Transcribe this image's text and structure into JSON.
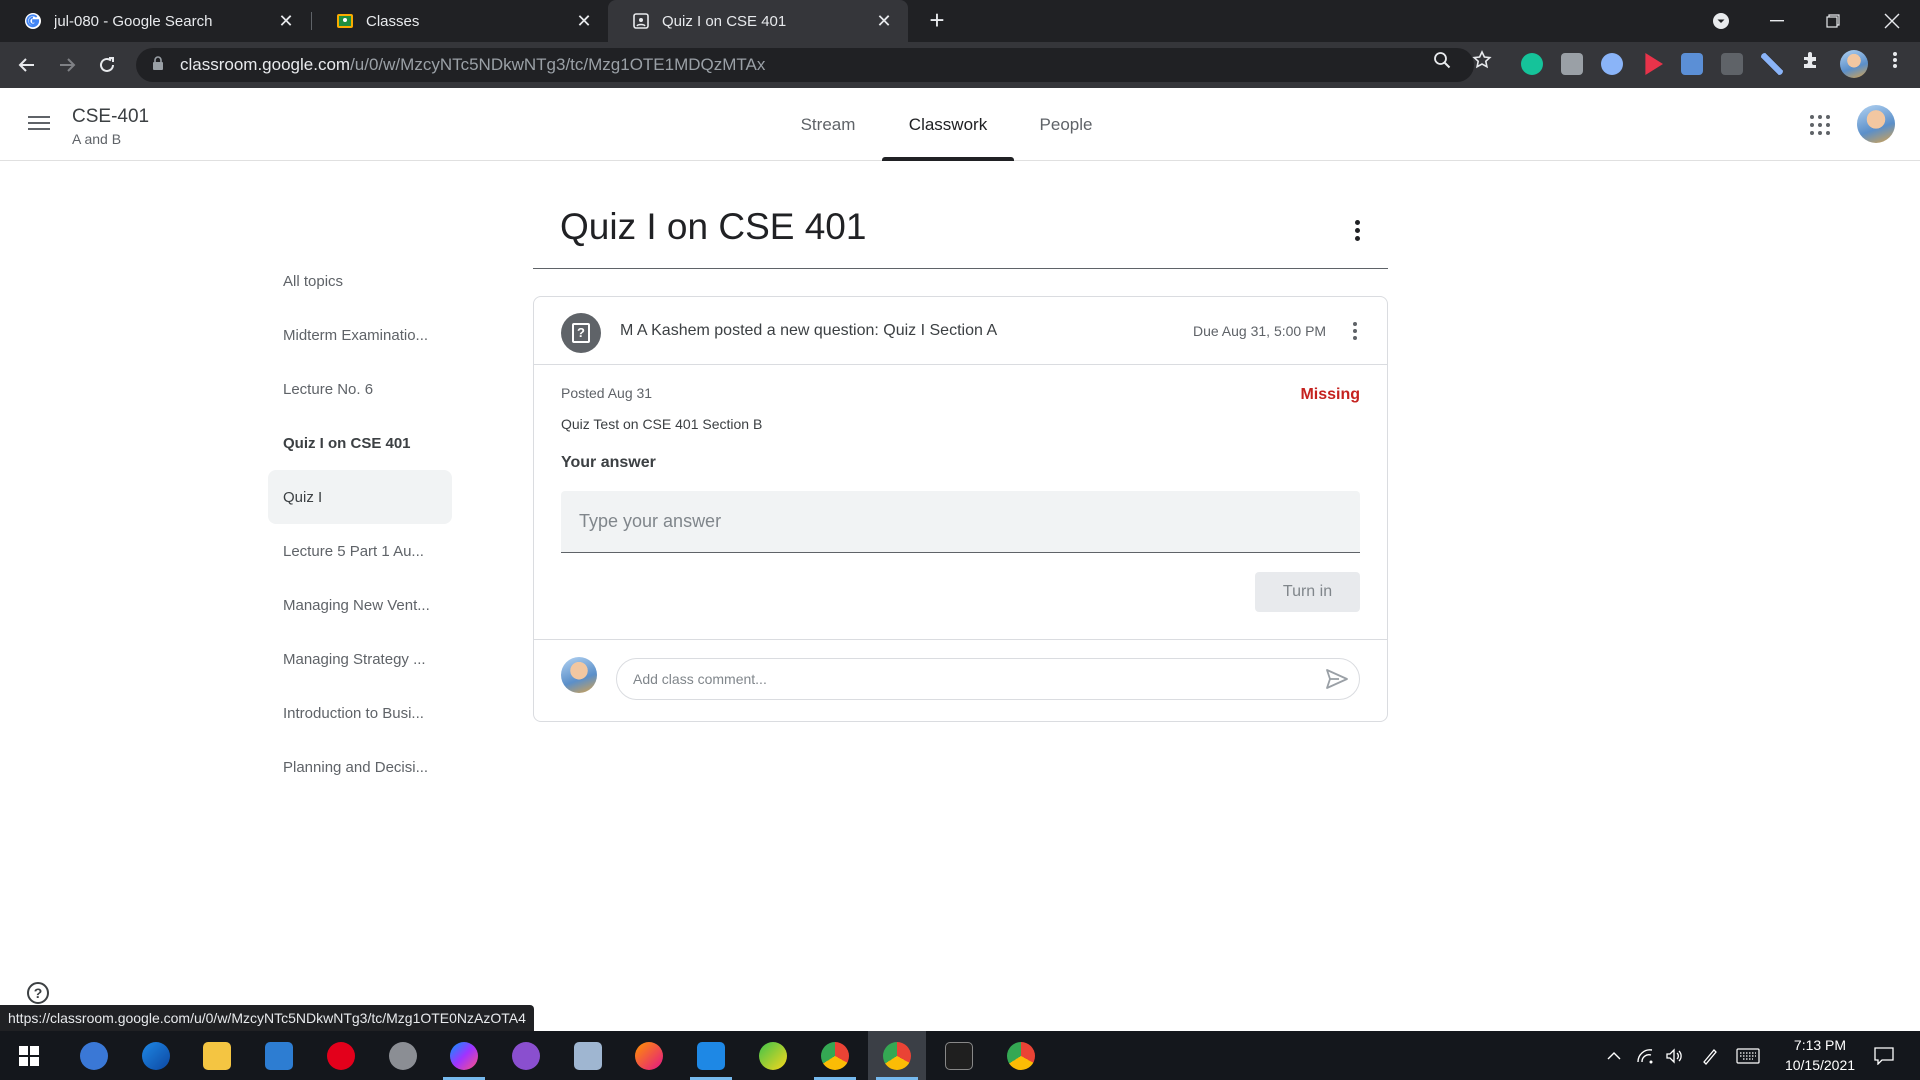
{
  "browser": {
    "tabs": [
      {
        "title": "jul-080 - Google Search",
        "favicon": "google-g-icon"
      },
      {
        "title": "Classes",
        "favicon": "classroom-icon"
      },
      {
        "title": "Quiz I on CSE 401",
        "favicon": "classroom-assignment-icon",
        "active": true
      }
    ],
    "url_domain": "classroom.google.com",
    "url_path": "/u/0/w/MzcyNTc5NDkwNTg3/tc/Mzg1OTE1MDQzMTAx",
    "status_url": "https://classroom.google.com/u/0/w/MzcyNTc5NDkwNTg3/tc/Mzg1OTE0NzAzOTA4"
  },
  "header": {
    "class_name": "CSE-401",
    "class_section": "A and B",
    "tabs": [
      "Stream",
      "Classwork",
      "People"
    ],
    "active_tab": "Classwork"
  },
  "topics": [
    {
      "label": "All topics",
      "style": "normal"
    },
    {
      "label": "Midterm Examinatio...",
      "style": "normal"
    },
    {
      "label": "Lecture No. 6",
      "style": "normal"
    },
    {
      "label": "Quiz I on CSE 401",
      "style": "bold"
    },
    {
      "label": "Quiz I",
      "style": "selected"
    },
    {
      "label": "Lecture 5 Part 1 Au...",
      "style": "normal"
    },
    {
      "label": "Managing New Vent...",
      "style": "normal"
    },
    {
      "label": "Managing Strategy ...",
      "style": "normal"
    },
    {
      "label": "Introduction to Busi...",
      "style": "normal"
    },
    {
      "label": "Planning and Decisi...",
      "style": "normal"
    }
  ],
  "main": {
    "title": "Quiz I on CSE 401",
    "card": {
      "posted_by": "M A Kashem posted a new question: Quiz I Section A",
      "due": "Due Aug 31, 5:00 PM",
      "posted_date": "Posted Aug 31",
      "status": "Missing",
      "description": "Quiz Test on CSE 401 Section B",
      "answer_label": "Your answer",
      "answer_placeholder": "Type your answer",
      "turn_in_label": "Turn in",
      "comment_placeholder": "Add class comment..."
    }
  },
  "taskbar": {
    "time": "7:13 PM",
    "date": "10/15/2021"
  },
  "colors": {
    "missing": "#c5221f",
    "browser_dark": "#202124",
    "active_tab_indicator": "#202124"
  }
}
